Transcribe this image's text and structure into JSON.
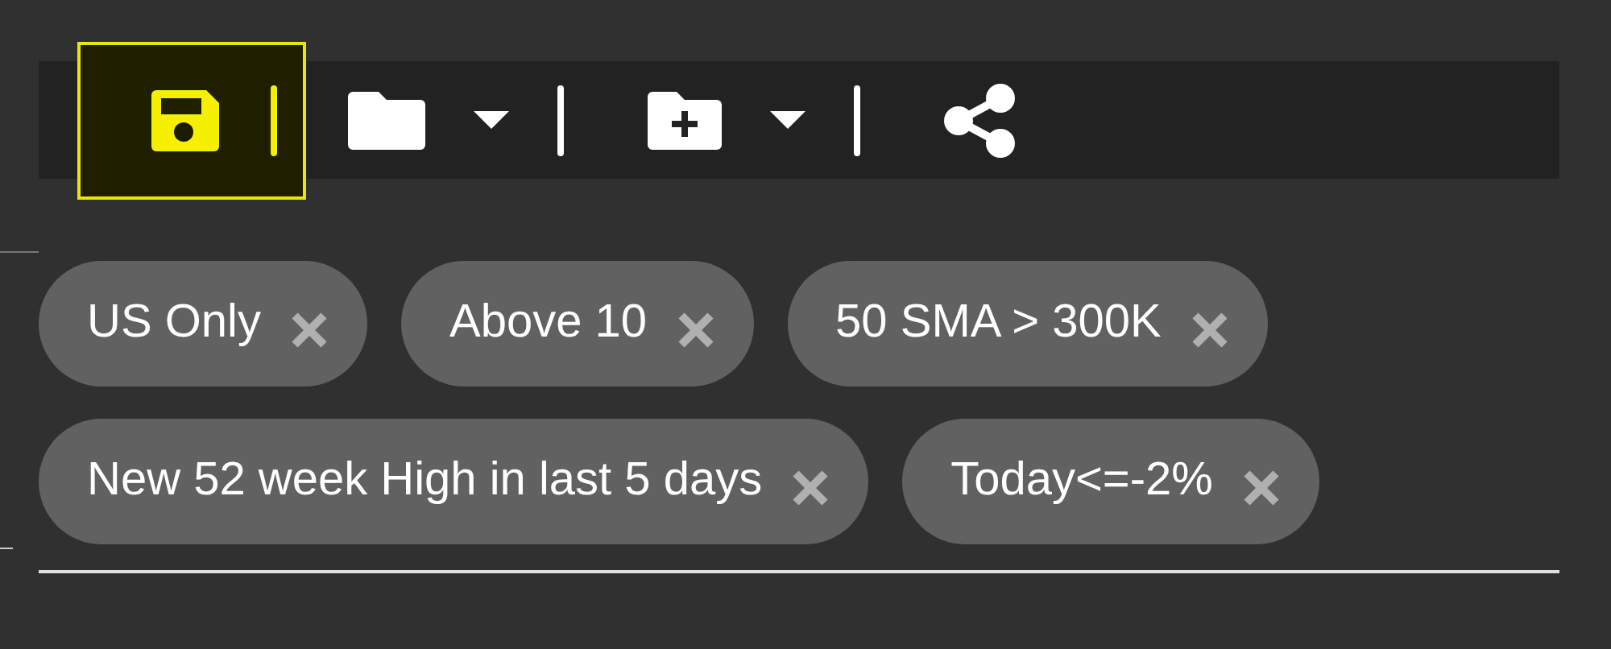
{
  "toolbar": [
    {
      "kind": "save",
      "highlighted": true
    },
    {
      "kind": "folder",
      "highlighted": false
    },
    {
      "kind": "new-folder",
      "highlighted": false
    },
    {
      "kind": "share",
      "highlighted": false
    }
  ],
  "filters": [
    {
      "label": "US Only"
    },
    {
      "label": "Above 10"
    },
    {
      "label": "50 SMA > 300K"
    },
    {
      "label": "New 52 week High in last 5 days"
    },
    {
      "label": "Today<=-2%"
    }
  ]
}
